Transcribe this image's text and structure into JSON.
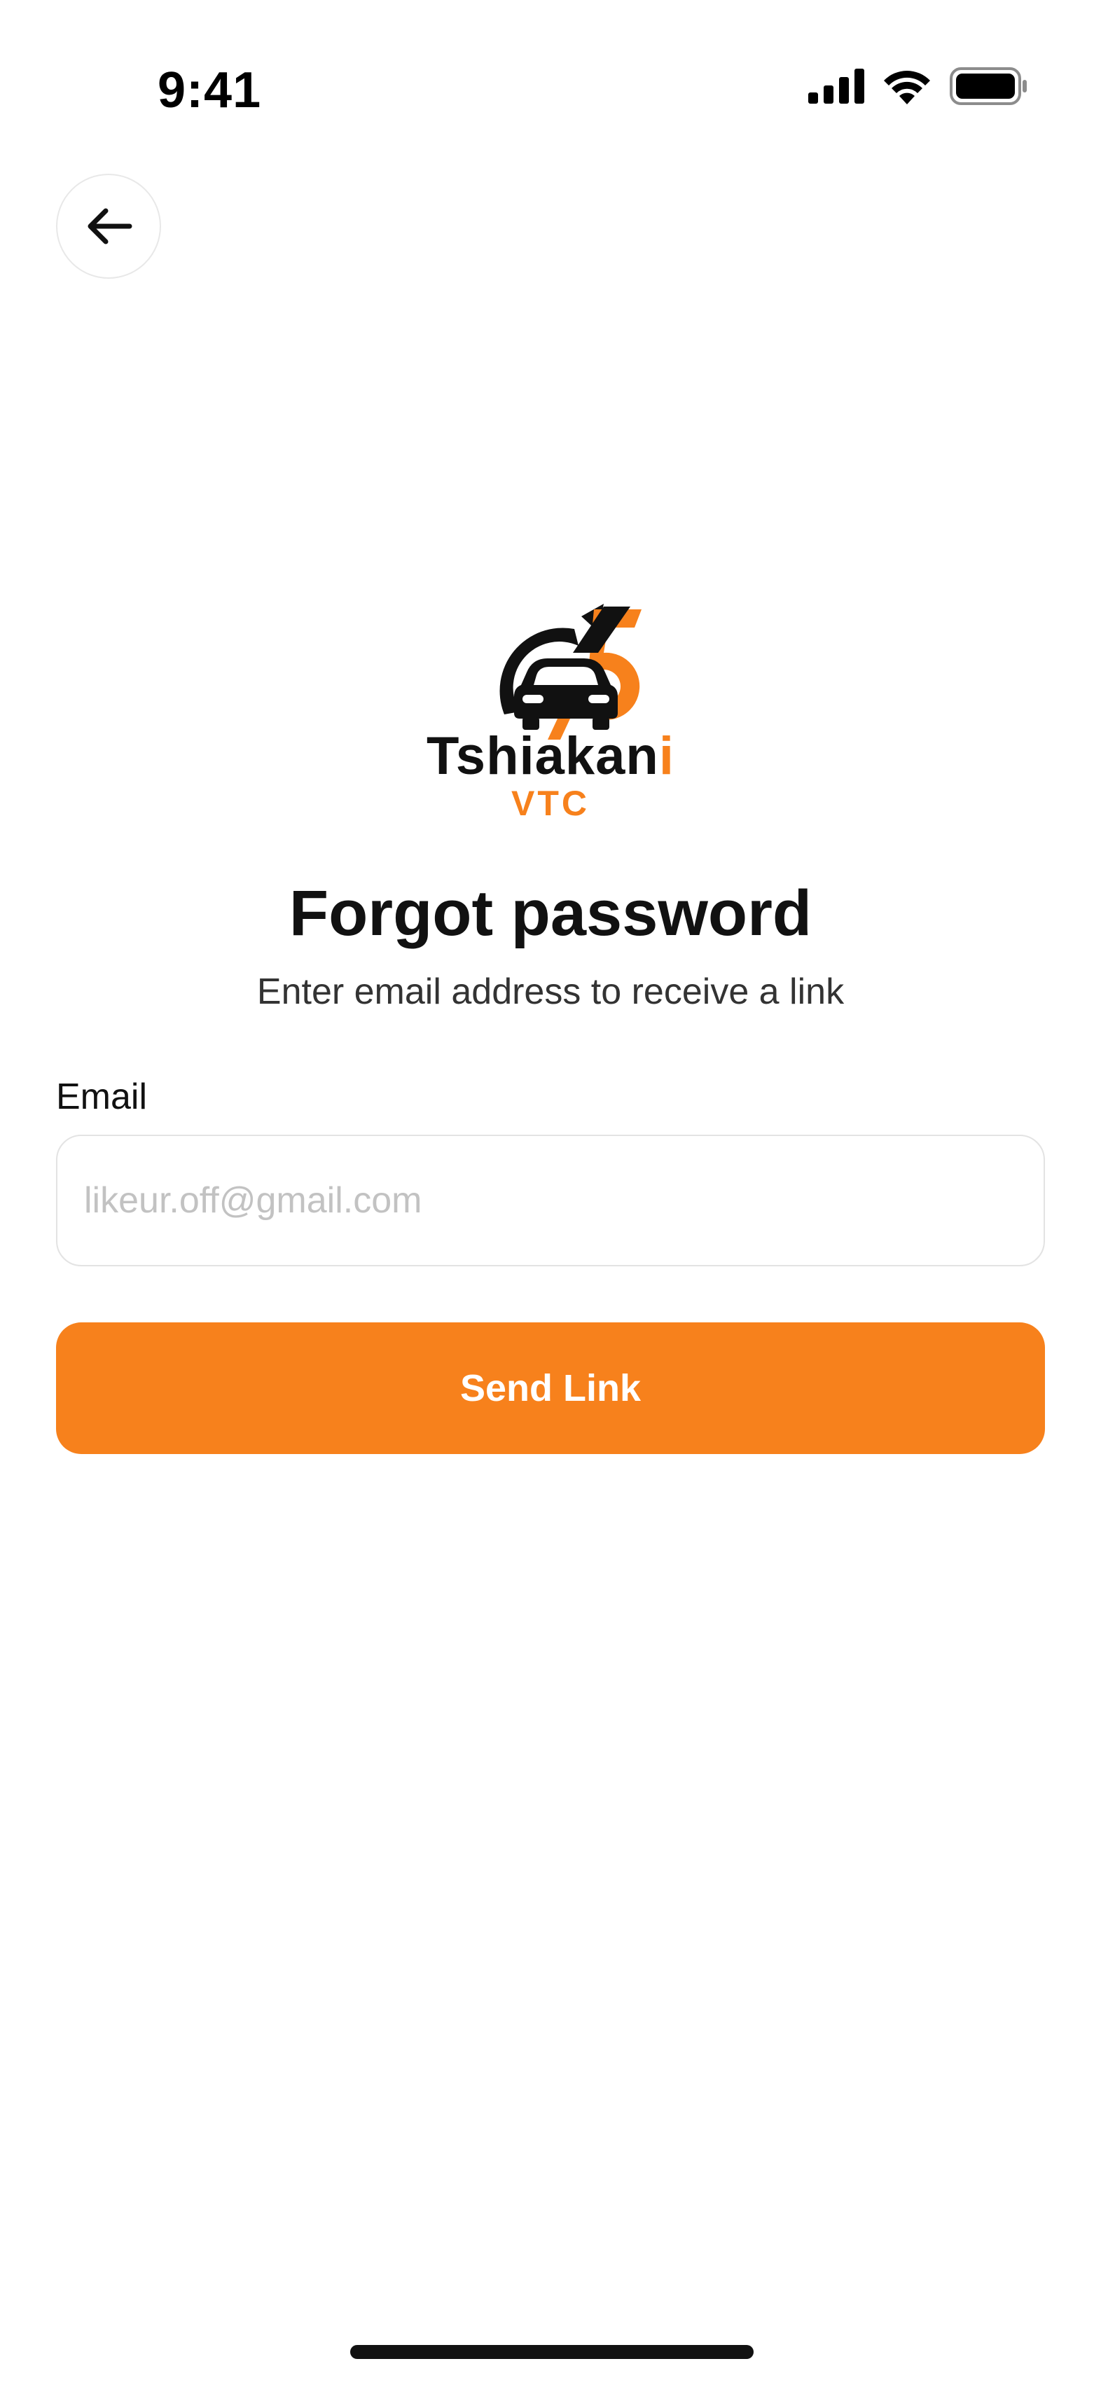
{
  "status_bar": {
    "time": "9:41"
  },
  "icons": {
    "back": "arrow-left-icon",
    "signal": "cellular-signal-icon",
    "wifi": "wifi-icon",
    "battery": "battery-icon"
  },
  "brand": {
    "name_main": "Tshiakan",
    "name_accent": "i",
    "subtitle": "VTC"
  },
  "page": {
    "title": "Forgot password",
    "subtitle": "Enter email address to receive a link"
  },
  "form": {
    "email_label": "Email",
    "email_value": "",
    "email_placeholder": "likeur.off@gmail.com",
    "submit_label": "Send Link"
  },
  "colors": {
    "accent": "#f7811c",
    "text": "#111111",
    "placeholder": "#c2c2c2",
    "border": "#e3e3e3"
  }
}
